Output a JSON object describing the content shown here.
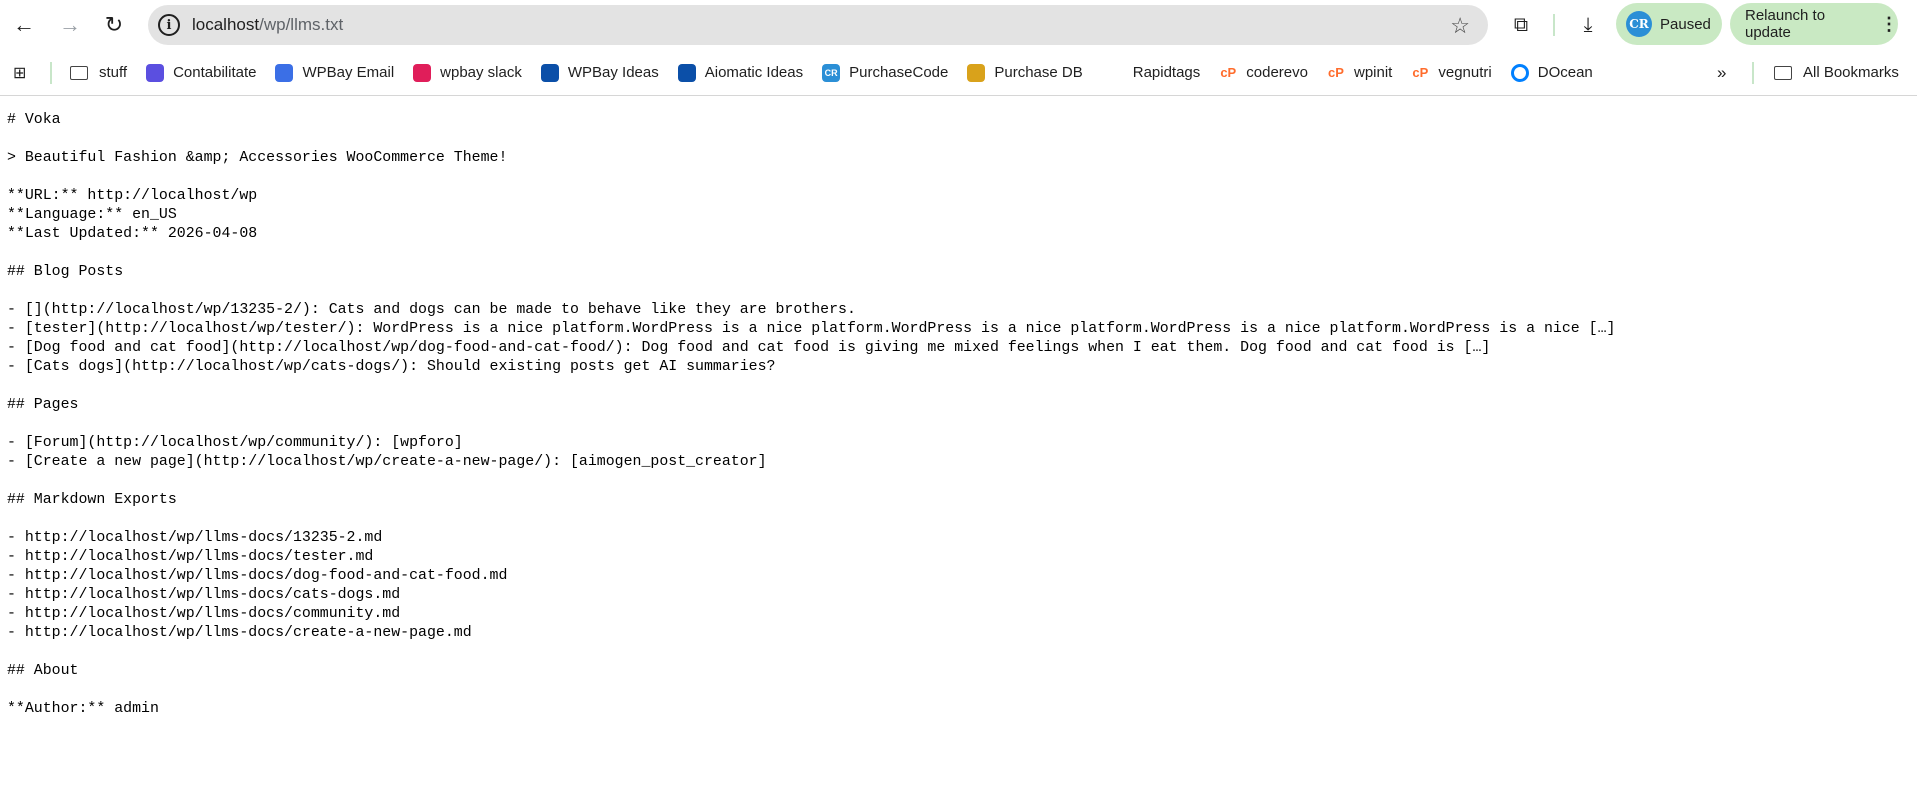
{
  "browser": {
    "url_host": "localhost",
    "url_path": "/wp/llms.txt",
    "profile_status": "Paused",
    "profile_initials": "CR",
    "relaunch_label": "Relaunch to update"
  },
  "bookmarks": {
    "items": [
      {
        "label": "stuff",
        "icon": "folder-icon"
      },
      {
        "label": "Contabilitate",
        "icon": "check-app-icon",
        "color": "#5b4fe0"
      },
      {
        "label": "WPBay Email",
        "icon": "mail-icon",
        "color": "#3b6fe6"
      },
      {
        "label": "wpbay slack",
        "icon": "slack-icon",
        "color": "#e01e5a"
      },
      {
        "label": "WPBay Ideas",
        "icon": "trello-icon",
        "color": "#0b4fa8"
      },
      {
        "label": "Aiomatic Ideas",
        "icon": "trello-icon",
        "color": "#0b4fa8"
      },
      {
        "label": "PurchaseCode",
        "icon": "cr-icon",
        "color": "#2b8fd6"
      },
      {
        "label": "Purchase DB",
        "icon": "db-icon",
        "color": "#d9a21b"
      },
      {
        "label": "Rapidtags",
        "icon": "blank-icon"
      },
      {
        "label": "coderevo",
        "icon": "cpanel-icon",
        "color": "#ff6c2c"
      },
      {
        "label": "wpinit",
        "icon": "cpanel-icon",
        "color": "#ff6c2c"
      },
      {
        "label": "vegnutri",
        "icon": "cpanel-icon",
        "color": "#ff6c2c"
      },
      {
        "label": "DOcean",
        "icon": "digitalocean-icon",
        "color": "#0080ff"
      }
    ],
    "overflow": "»",
    "all_bookmarks": "All Bookmarks"
  },
  "document": {
    "lines": [
      "# Voka",
      "",
      "> Beautiful Fashion &amp; Accessories WooCommerce Theme!",
      "",
      "**URL:** http://localhost/wp",
      "**Language:** en_US",
      "**Last Updated:** 2026-04-08",
      "",
      "## Blog Posts",
      "",
      "- [](http://localhost/wp/13235-2/): Cats and dogs can be made to behave like they are brothers.",
      "- [tester](http://localhost/wp/tester/): WordPress is a nice platform.WordPress is a nice platform.WordPress is a nice platform.WordPress is a nice platform.WordPress is a nice […]",
      "- [Dog food and cat food](http://localhost/wp/dog-food-and-cat-food/): Dog food and cat food is giving me mixed feelings when I eat them. Dog food and cat food is […]",
      "- [Cats dogs](http://localhost/wp/cats-dogs/): Should existing posts get AI summaries?",
      "",
      "## Pages",
      "",
      "- [Forum](http://localhost/wp/community/): [wpforo]",
      "- [Create a new page](http://localhost/wp/create-a-new-page/): [aimogen_post_creator]",
      "",
      "## Markdown Exports",
      "",
      "- http://localhost/wp/llms-docs/13235-2.md",
      "- http://localhost/wp/llms-docs/tester.md",
      "- http://localhost/wp/llms-docs/dog-food-and-cat-food.md",
      "- http://localhost/wp/llms-docs/cats-dogs.md",
      "- http://localhost/wp/llms-docs/community.md",
      "- http://localhost/wp/llms-docs/create-a-new-page.md",
      "",
      "## About",
      "",
      "**Author:** admin"
    ]
  }
}
